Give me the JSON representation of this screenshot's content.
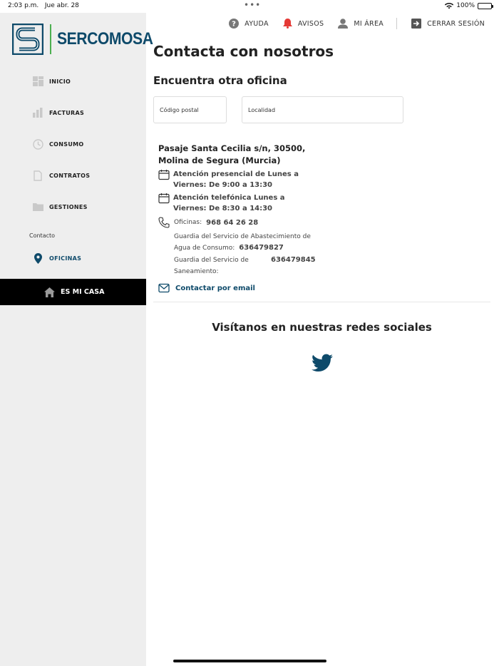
{
  "status_bar": {
    "time": "2:03 p.m.",
    "date": "Jue abr. 28",
    "battery": "100%"
  },
  "brand": {
    "name": "SERCOMOSA",
    "primary_color": "#0e4a6a",
    "accent_color": "#4caf50"
  },
  "sidebar": {
    "items": [
      {
        "label": "INICIO",
        "icon": "dashboard-icon"
      },
      {
        "label": "FACTURAS",
        "icon": "bar-chart-icon"
      },
      {
        "label": "CONSUMO",
        "icon": "clock-icon"
      },
      {
        "label": "CONTRATOS",
        "icon": "document-icon"
      },
      {
        "label": "GESTIONES",
        "icon": "folder-icon"
      }
    ],
    "section_label": "Contacto",
    "active_item": {
      "label": "OFICINAS",
      "icon": "location-pin-icon"
    },
    "home_button": "ES MI CASA"
  },
  "topnav": {
    "help": "AYUDA",
    "alerts": "AVISOS",
    "my_area": "MI ÁREA",
    "logout": "CERRAR SESIÓN"
  },
  "main": {
    "title": "Contacta con nosotros",
    "subtitle": "Encuentra otra oficina",
    "postal_code_placeholder": "Código postal",
    "locality_placeholder": "Localidad",
    "office": {
      "address_line1": "Pasaje Santa Cecilia s/n, 30500,",
      "address_line2": "Molina de Segura (Murcia)",
      "in_person_hours": "Atención presencial de Lunes a Viernes: De 9:00 a 13:30",
      "phone_hours": "Atención telefónica Lunes a Viernes: De 8:30 a 14:30",
      "offices_label": "Oficinas:",
      "offices_phone": "968 64 26 28",
      "water_guard_label": "Guardia del Servicio de Abastecimiento de Agua de Consumo:",
      "water_guard_phone": "636479827",
      "sanitation_guard_label": "Guardia del Servicio de Saneamiento:",
      "sanitation_guard_phone": "636479845",
      "email_link": "Contactar por email"
    },
    "social_title": "Visítanos en nuestras redes sociales"
  }
}
